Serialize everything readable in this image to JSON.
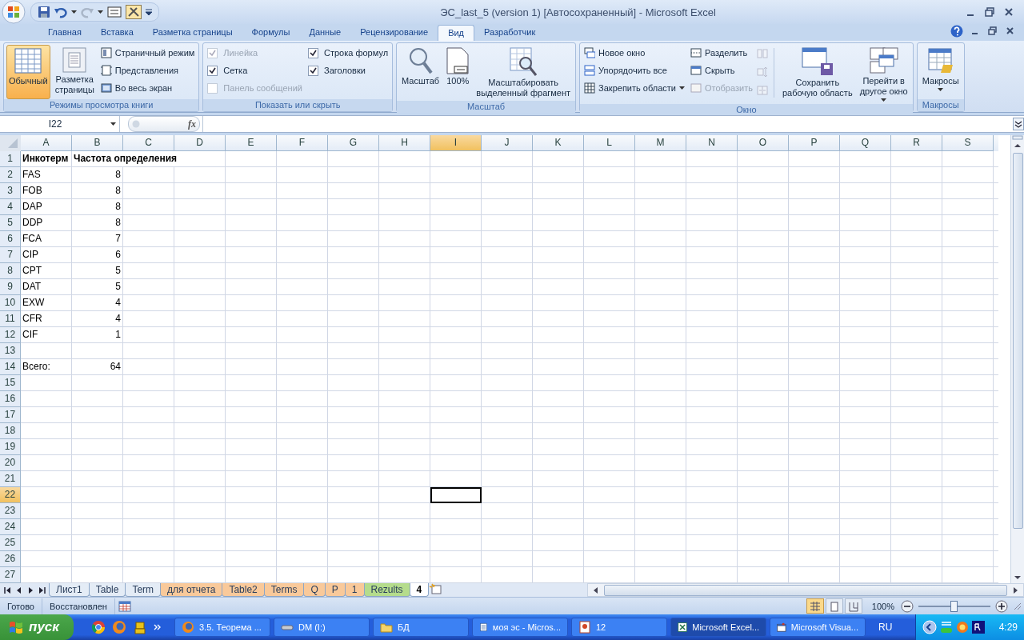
{
  "window": {
    "title": "ЭС_last_5 (version 1) [Автосохраненный] - Microsoft Excel"
  },
  "ribbon_tabs": [
    {
      "label": "Главная",
      "selected": false
    },
    {
      "label": "Вставка",
      "selected": false
    },
    {
      "label": "Разметка страницы",
      "selected": false
    },
    {
      "label": "Формулы",
      "selected": false
    },
    {
      "label": "Данные",
      "selected": false
    },
    {
      "label": "Рецензирование",
      "selected": false
    },
    {
      "label": "Вид",
      "selected": true
    },
    {
      "label": "Разработчик",
      "selected": false
    }
  ],
  "ribbon": {
    "groups": [
      {
        "label": "Режимы просмотра книги",
        "items": [
          {
            "kind": "large",
            "label": "Обычный",
            "selected": true
          },
          {
            "kind": "large",
            "label": "Разметка\nстраницы",
            "selected": false
          },
          {
            "kind": "small",
            "label": "Страничный режим",
            "selected": false
          },
          {
            "kind": "small",
            "label": "Представления",
            "selected": false
          },
          {
            "kind": "small",
            "label": "Во весь экран",
            "selected": false
          }
        ]
      },
      {
        "label": "Показать или скрыть",
        "items": [
          {
            "kind": "checkbox",
            "label": "Линейка",
            "checked": true,
            "disabled": true
          },
          {
            "kind": "checkbox",
            "label": "Сетка",
            "checked": true,
            "disabled": false
          },
          {
            "kind": "checkbox",
            "label": "Панель сообщений",
            "checked": false,
            "disabled": true
          },
          {
            "kind": "checkbox",
            "label": "Строка формул",
            "checked": true,
            "disabled": false
          },
          {
            "kind": "checkbox",
            "label": "Заголовки",
            "checked": true,
            "disabled": false
          }
        ]
      },
      {
        "label": "Масштаб",
        "items": [
          {
            "kind": "large",
            "label": "Масштаб"
          },
          {
            "kind": "large",
            "label": "100%"
          },
          {
            "kind": "large",
            "label": "Масштабировать\nвыделенный фрагмент"
          }
        ]
      },
      {
        "label": "Окно",
        "items": [
          {
            "kind": "small",
            "label": "Новое окно",
            "disabled": false
          },
          {
            "kind": "small",
            "label": "Упорядочить все",
            "disabled": false
          },
          {
            "kind": "small",
            "label": "Закрепить области",
            "dropdown": true,
            "disabled": false
          },
          {
            "kind": "small",
            "label": "Разделить",
            "disabled": false
          },
          {
            "kind": "small",
            "label": "Скрыть",
            "disabled": false
          },
          {
            "kind": "small",
            "label": "Отобразить",
            "disabled": true
          },
          {
            "kind": "icon",
            "disabled": true
          },
          {
            "kind": "icon",
            "disabled": true
          },
          {
            "kind": "icon",
            "disabled": true
          },
          {
            "kind": "large",
            "label": "Сохранить\nрабочую область"
          },
          {
            "kind": "large",
            "label": "Перейти в\nдругое окно",
            "dropdown": true
          }
        ]
      },
      {
        "label": "Макросы",
        "items": [
          {
            "kind": "large",
            "label": "Макросы",
            "dropdown": true
          }
        ]
      }
    ]
  },
  "formula_bar": {
    "name_box": "I22",
    "function_button": "fx"
  },
  "sheet": {
    "columns": [
      {
        "label": "A",
        "selected": false
      },
      {
        "label": "B",
        "selected": false
      },
      {
        "label": "C",
        "selected": false
      },
      {
        "label": "D",
        "selected": false
      },
      {
        "label": "E",
        "selected": false
      },
      {
        "label": "F",
        "selected": false
      },
      {
        "label": "G",
        "selected": false
      },
      {
        "label": "H",
        "selected": false
      },
      {
        "label": "I",
        "selected": true
      },
      {
        "label": "J",
        "selected": false
      },
      {
        "label": "K",
        "selected": false
      },
      {
        "label": "L",
        "selected": false
      },
      {
        "label": "M",
        "selected": false
      },
      {
        "label": "N",
        "selected": false
      },
      {
        "label": "O",
        "selected": false
      },
      {
        "label": "P",
        "selected": false
      },
      {
        "label": "Q",
        "selected": false
      },
      {
        "label": "R",
        "selected": false
      },
      {
        "label": "S",
        "selected": false
      }
    ],
    "rows": [
      {
        "label": "1",
        "selected": false,
        "cells": [
          {
            "text": "Инкотерм",
            "kind": "text",
            "bold": true
          },
          {
            "text": "Частота определения",
            "kind": "text",
            "bold": true
          }
        ]
      },
      {
        "label": "2",
        "selected": false,
        "cells": [
          {
            "text": "FAS",
            "kind": "text"
          },
          {
            "text": "8",
            "kind": "number"
          }
        ]
      },
      {
        "label": "3",
        "selected": false,
        "cells": [
          {
            "text": "FOB",
            "kind": "text"
          },
          {
            "text": "8",
            "kind": "number"
          }
        ]
      },
      {
        "label": "4",
        "selected": false,
        "cells": [
          {
            "text": "DAP",
            "kind": "text"
          },
          {
            "text": "8",
            "kind": "number"
          }
        ]
      },
      {
        "label": "5",
        "selected": false,
        "cells": [
          {
            "text": "DDP",
            "kind": "text"
          },
          {
            "text": "8",
            "kind": "number"
          }
        ]
      },
      {
        "label": "6",
        "selected": false,
        "cells": [
          {
            "text": "FCA",
            "kind": "text"
          },
          {
            "text": "7",
            "kind": "number"
          }
        ]
      },
      {
        "label": "7",
        "selected": false,
        "cells": [
          {
            "text": "CIP",
            "kind": "text"
          },
          {
            "text": "6",
            "kind": "number"
          }
        ]
      },
      {
        "label": "8",
        "selected": false,
        "cells": [
          {
            "text": "CPT",
            "kind": "text"
          },
          {
            "text": "5",
            "kind": "number"
          }
        ]
      },
      {
        "label": "9",
        "selected": false,
        "cells": [
          {
            "text": "DAT",
            "kind": "text"
          },
          {
            "text": "5",
            "kind": "number"
          }
        ]
      },
      {
        "label": "10",
        "selected": false,
        "cells": [
          {
            "text": "EXW",
            "kind": "text"
          },
          {
            "text": "4",
            "kind": "number"
          }
        ]
      },
      {
        "label": "11",
        "selected": false,
        "cells": [
          {
            "text": "CFR",
            "kind": "text"
          },
          {
            "text": "4",
            "kind": "number"
          }
        ]
      },
      {
        "label": "12",
        "selected": false,
        "cells": [
          {
            "text": "CIF",
            "kind": "text"
          },
          {
            "text": "1",
            "kind": "number"
          }
        ]
      },
      {
        "label": "13",
        "selected": false
      },
      {
        "label": "14",
        "selected": false,
        "cells": [
          {
            "text": "Всего:",
            "kind": "text"
          },
          {
            "text": "64",
            "kind": "number"
          }
        ]
      },
      {
        "label": "15",
        "selected": false
      },
      {
        "label": "16",
        "selected": false
      },
      {
        "label": "17",
        "selected": false
      },
      {
        "label": "18",
        "selected": false
      },
      {
        "label": "19",
        "selected": false
      },
      {
        "label": "20",
        "selected": false
      },
      {
        "label": "21",
        "selected": false
      },
      {
        "label": "22",
        "selected": true
      },
      {
        "label": "23",
        "selected": false
      },
      {
        "label": "24",
        "selected": false
      },
      {
        "label": "25",
        "selected": false
      },
      {
        "label": "26",
        "selected": false
      },
      {
        "label": "27",
        "selected": false
      }
    ]
  },
  "sheet_tabs": [
    {
      "label": "Лист1",
      "selected": false
    },
    {
      "label": "Table",
      "selected": false
    },
    {
      "label": "Term",
      "selected": false
    },
    {
      "label": "для отчета",
      "selected": false,
      "color": "#f9c99a"
    },
    {
      "label": "Table2",
      "selected": false,
      "color": "#f9c99a"
    },
    {
      "label": "Terms",
      "selected": false,
      "color": "#f9c99a"
    },
    {
      "label": "Q",
      "selected": false,
      "color": "#f9c99a"
    },
    {
      "label": "P",
      "selected": false,
      "color": "#f9c99a"
    },
    {
      "label": "1",
      "selected": false,
      "color": "#f9c99a"
    },
    {
      "label": "Rezults",
      "selected": false,
      "color": "#b5dc8c"
    },
    {
      "label": "4",
      "selected": true
    }
  ],
  "status_bar": {
    "texts": [
      "Готово",
      "Восстановлен"
    ],
    "view_buttons": [
      {
        "selected": true
      },
      {
        "selected": false
      },
      {
        "selected": false
      }
    ],
    "zoom": "100%",
    "zoom_slider": {
      "level": 0.5
    }
  },
  "taskbar": {
    "start": "пуск",
    "windows": [
      {
        "label": "3.5. Теорема ...",
        "selected": false
      },
      {
        "label": "DM (I:)",
        "selected": false
      },
      {
        "label": "БД",
        "selected": false
      },
      {
        "label": "моя эс - Micros...",
        "selected": false
      },
      {
        "label": "12",
        "selected": false
      },
      {
        "label": "Microsoft Excel...",
        "selected": true
      },
      {
        "label": "Microsoft Visua...",
        "selected": false
      }
    ],
    "language": "RU",
    "clock": "4:29"
  }
}
